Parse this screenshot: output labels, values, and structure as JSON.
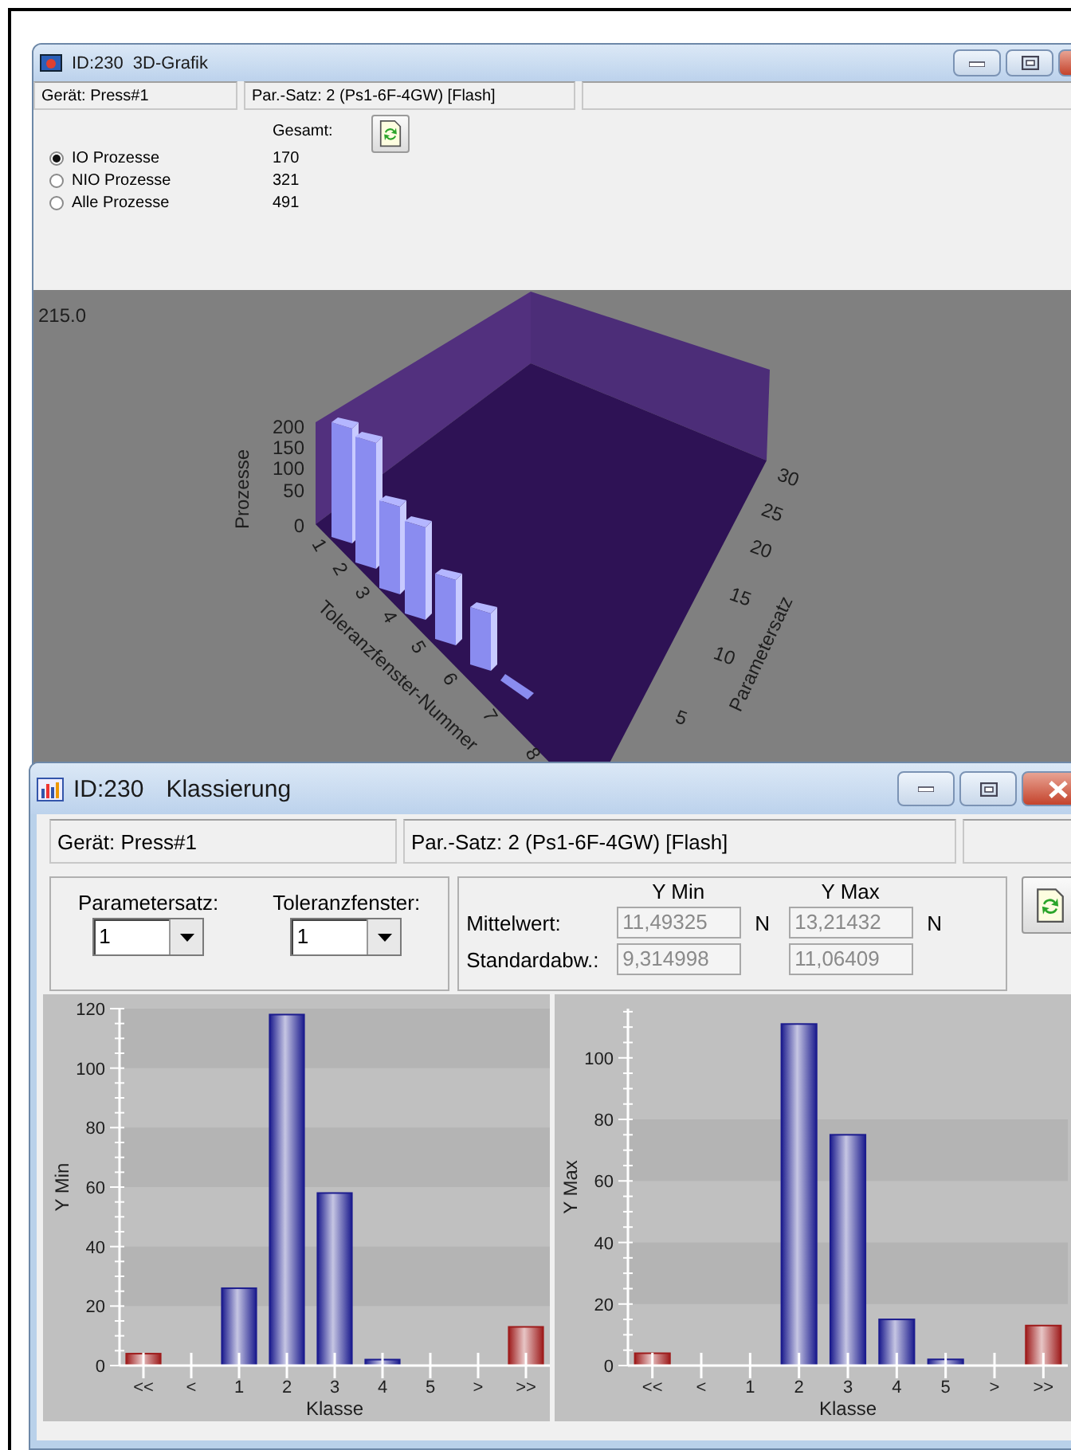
{
  "back_window": {
    "title_id": "ID:230",
    "title": "3D-Grafik",
    "status": [
      "Gerät: Press#1",
      "Par.-Satz: 2 (Ps1-6F-4GW) [Flash]"
    ],
    "total_header": "Gesamt:",
    "filters": [
      {
        "label": "IO Prozesse",
        "count": "170",
        "selected": true
      },
      {
        "label": "NIO Prozesse",
        "count": "321",
        "selected": false
      },
      {
        "label": "Alle Prozesse",
        "count": "491",
        "selected": false
      }
    ],
    "chart_3d": {
      "corner_value": "215.0",
      "z_label": "Prozesse",
      "z_ticks": [
        "200",
        "150",
        "100",
        "50",
        "0"
      ],
      "x_label": "Toleranzfenster-Nummer",
      "x_ticks": [
        "1",
        "2",
        "3",
        "4",
        "5",
        "6",
        "7",
        "8"
      ],
      "y_label": "Parametersatz",
      "y_ticks": [
        "30",
        "25",
        "20",
        "15",
        "10",
        "5"
      ]
    }
  },
  "front_window": {
    "title_id": "ID:230",
    "title": "Klassierung",
    "status": [
      "Gerät: Press#1",
      "Par.-Satz: 2 (Ps1-6F-4GW) [Flash]"
    ],
    "selectors": [
      {
        "label": "Parametersatz:",
        "value": "1"
      },
      {
        "label": "Toleranzfenster:",
        "value": "1"
      }
    ],
    "stats": {
      "columns": [
        "Y Min",
        "Y Max"
      ],
      "rows": [
        {
          "label": "Mittelwert:",
          "values": [
            "11,49325",
            "13,21432"
          ],
          "units": [
            "N",
            "N"
          ]
        },
        {
          "label": "Standardabw.:",
          "values": [
            "9,314998",
            "11,06409"
          ]
        }
      ]
    },
    "charts": [
      {
        "chart_data": {
          "type": "bar",
          "ylabel": "Y Min",
          "xlabel": "Klasse",
          "categories": [
            "<<",
            "<",
            "1",
            "2",
            "3",
            "4",
            "5",
            ">",
            ">>"
          ],
          "stacked": true,
          "ylim": [
            0,
            120
          ],
          "yticks": [
            0,
            20,
            40,
            60,
            80,
            100,
            120
          ],
          "series": [
            {
              "color": "#1c1c8e",
              "values": [
                null,
                null,
                26,
                118,
                58,
                2,
                null,
                null,
                null
              ]
            },
            {
              "color": "#9e1c1c",
              "values": [
                4,
                null,
                null,
                null,
                null,
                null,
                null,
                null,
                13
              ]
            }
          ]
        }
      },
      {
        "chart_data": {
          "type": "bar",
          "ylabel": "Y Max",
          "xlabel": "Klasse",
          "categories": [
            "<<",
            "<",
            "1",
            "2",
            "3",
            "4",
            "5",
            ">",
            ">>"
          ],
          "stacked": true,
          "ylim": [
            0,
            116
          ],
          "yticks": [
            0,
            20,
            40,
            60,
            80,
            100
          ],
          "series": [
            {
              "color": "#1c1c8e",
              "values": [
                null,
                null,
                null,
                111,
                75,
                15,
                2,
                null,
                null
              ]
            },
            {
              "color": "#9e1c1c",
              "values": [
                4,
                null,
                null,
                null,
                null,
                null,
                null,
                null,
                13
              ]
            }
          ]
        }
      }
    ]
  }
}
